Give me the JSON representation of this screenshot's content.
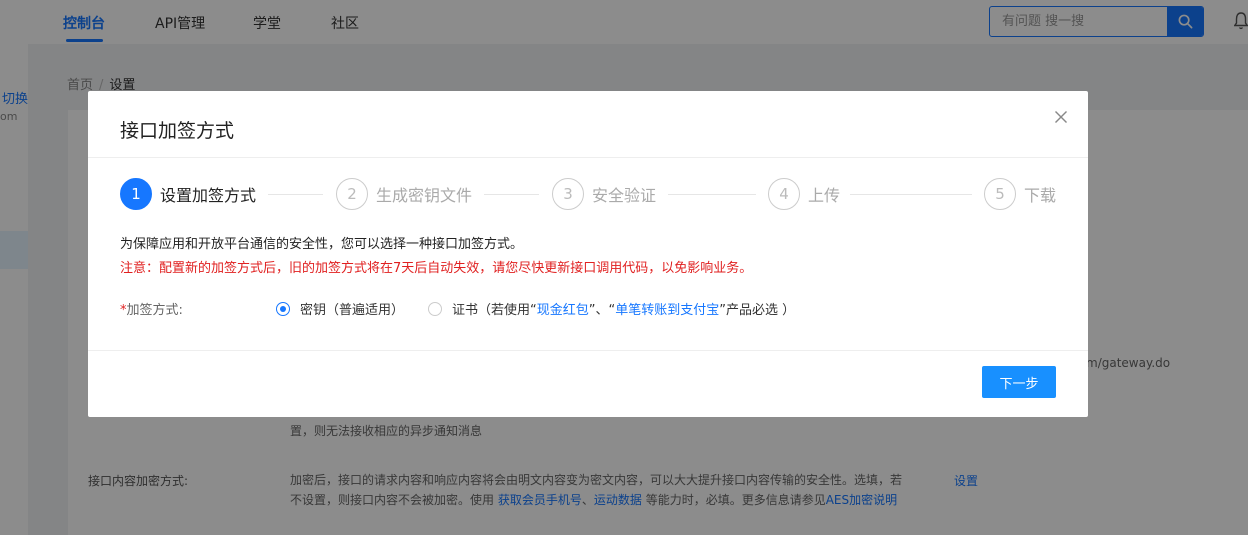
{
  "topnav": {
    "items": [
      {
        "label": "控制台",
        "active": true
      },
      {
        "label": "API管理",
        "active": false
      },
      {
        "label": "学堂",
        "active": false
      },
      {
        "label": "社区",
        "active": false
      }
    ],
    "search_placeholder": "有问题 搜一搜",
    "accent_color": "#1677ff"
  },
  "sidebar": {
    "switch_label": "切换",
    "partial_text": "om"
  },
  "breadcrumb": {
    "home": "首页",
    "separator": "/",
    "current": "设置"
  },
  "background": {
    "gateway_text": "m/gateway.do",
    "notify_text": "置，则无法接收相应的异步通知消息",
    "encrypt_label": "接口内容加密方式:",
    "encrypt_desc_1": "加密后，接口的请求内容和响应内容将会由明文内容变为密文内容，可以大大提升接口内容传输的安全性。选填，若",
    "encrypt_desc_2": "不设置，则接口内容不会被加密。使用 ",
    "encrypt_link_1": "获取会员手机号",
    "encrypt_sep": "、",
    "encrypt_link_2": "运动数据",
    "encrypt_desc_3": " 等能力时，必填。更多信息请参见",
    "encrypt_link_3": "AES加密说明",
    "setting_link": "设置"
  },
  "modal": {
    "title": "接口加签方式",
    "steps": [
      {
        "num": "1",
        "label": "设置加签方式",
        "active": true
      },
      {
        "num": "2",
        "label": "生成密钥文件",
        "active": false
      },
      {
        "num": "3",
        "label": "安全验证",
        "active": false
      },
      {
        "num": "4",
        "label": "上传",
        "active": false
      },
      {
        "num": "5",
        "label": "下载",
        "active": false
      }
    ],
    "intro": "为保障应用和开放平台通信的安全性，您可以选择一种接口加签方式。",
    "warning": "注意：配置新的加签方式后，旧的加签方式将在7天后自动失效，请您尽快更新接口调用代码，以免影响业务。",
    "form": {
      "required_mark": "*",
      "label": "加签方式:",
      "option_key": {
        "label": "密钥（普遍适用）",
        "checked": true
      },
      "option_cert": {
        "checked": false,
        "prefix": "证书（若使用“",
        "link_1": "现金红包",
        "middle": "”、“",
        "link_2": "单笔转账到支付宝",
        "suffix": "”产品必选 ）"
      }
    },
    "next_button": "下一步"
  }
}
